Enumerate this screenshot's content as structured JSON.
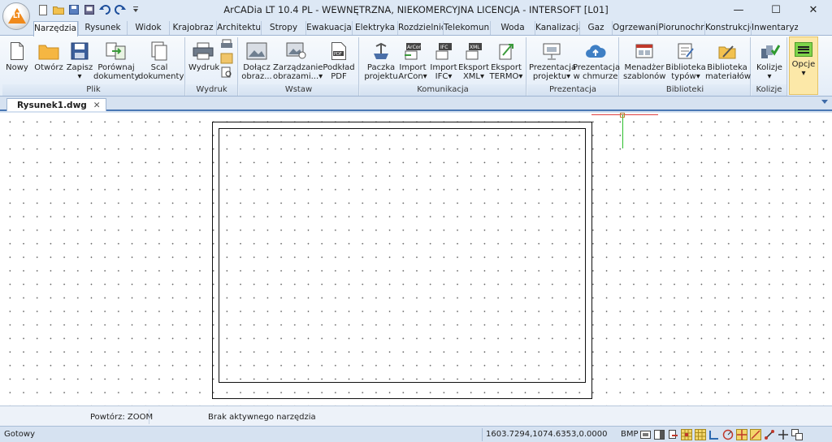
{
  "window": {
    "title": "ArCADia LT 10.4 PL - WEWNĘTRZNA, NIEKOMERCYJNA LICENCJA - INTERSOFT [L01]",
    "logo_text": "LT",
    "minimize": "—",
    "maximize": "☐",
    "close": "✕"
  },
  "quick_access": [
    "new-doc-icon",
    "open-folder-icon",
    "save-icon",
    "print-preview-icon",
    "undo-icon",
    "redo-icon",
    "customize-qat-icon"
  ],
  "ribbon_tabs": [
    {
      "label": "Narzędzia g",
      "active": true
    },
    {
      "label": "Rysunek"
    },
    {
      "label": "Widok"
    },
    {
      "label": "Krajobraz"
    },
    {
      "label": "Architektura"
    },
    {
      "label": "Stropy"
    },
    {
      "label": "Ewakuacja"
    },
    {
      "label": "Elektryka"
    },
    {
      "label": "Rozdzielnic"
    },
    {
      "label": "Telekomunil"
    },
    {
      "label": "Woda"
    },
    {
      "label": "Kanalizacja"
    },
    {
      "label": "Gaz"
    },
    {
      "label": "Ogrzewanie"
    },
    {
      "label": "Piorunochr"
    },
    {
      "label": "Konstrukcje"
    },
    {
      "label": "Inwentaryza"
    }
  ],
  "ribbon_groups": {
    "plik": {
      "label": "Plik",
      "buttons": [
        "Nowy",
        "Otwórz",
        "Zapisz\n▾",
        "Porównaj\ndokumenty",
        "Scal\ndokumenty"
      ]
    },
    "wydruk": {
      "label": "Wydruk",
      "buttons": [
        "Wydruk"
      ]
    },
    "wstaw": {
      "label": "Wstaw",
      "buttons": [
        "Dołącz\nobraz...",
        "Zarządzanie\nobrazami...▾",
        "Podkład\nPDF"
      ]
    },
    "komunikacja": {
      "label": "Komunikacja",
      "buttons": [
        "Paczka\nprojektu",
        "Import\nArCon▾",
        "Import\nIFC▾",
        "Eksport\nXML▾",
        "Eksport\nTERMO▾"
      ]
    },
    "prezentacja": {
      "label": "Prezentacja",
      "buttons": [
        "Prezentacja\nprojektu▾",
        "Prezentacja\nw chmurze"
      ]
    },
    "biblioteki": {
      "label": "Biblioteki",
      "buttons": [
        "Menadżer\nszablonów",
        "Biblioteka\ntypów▾",
        "Biblioteka\nmateriałów"
      ]
    },
    "kolizje": {
      "label": "Kolizje",
      "buttons": [
        "Kolizje\n▾"
      ]
    },
    "opcje": {
      "label": "Opcje",
      "buttons": [
        "Opcje\n▾"
      ]
    }
  },
  "document_tab": {
    "label": "Rysunek1.dwg",
    "close": "✕"
  },
  "command_line": {
    "repeat": "Powtórz: ZOOM",
    "status": "Brak aktywnego narzędzia"
  },
  "status_bar": {
    "ready": "Gotowy",
    "coords": "1603.7294,1074.6353,0.0000",
    "bmp": "BMP"
  },
  "colors": {
    "ribbon_bg": "#e4edf8",
    "accent": "#4a78b4",
    "opcje_highlight": "#fce8a8",
    "ucs_x": "#e04040",
    "ucs_y": "#2cc02c"
  }
}
